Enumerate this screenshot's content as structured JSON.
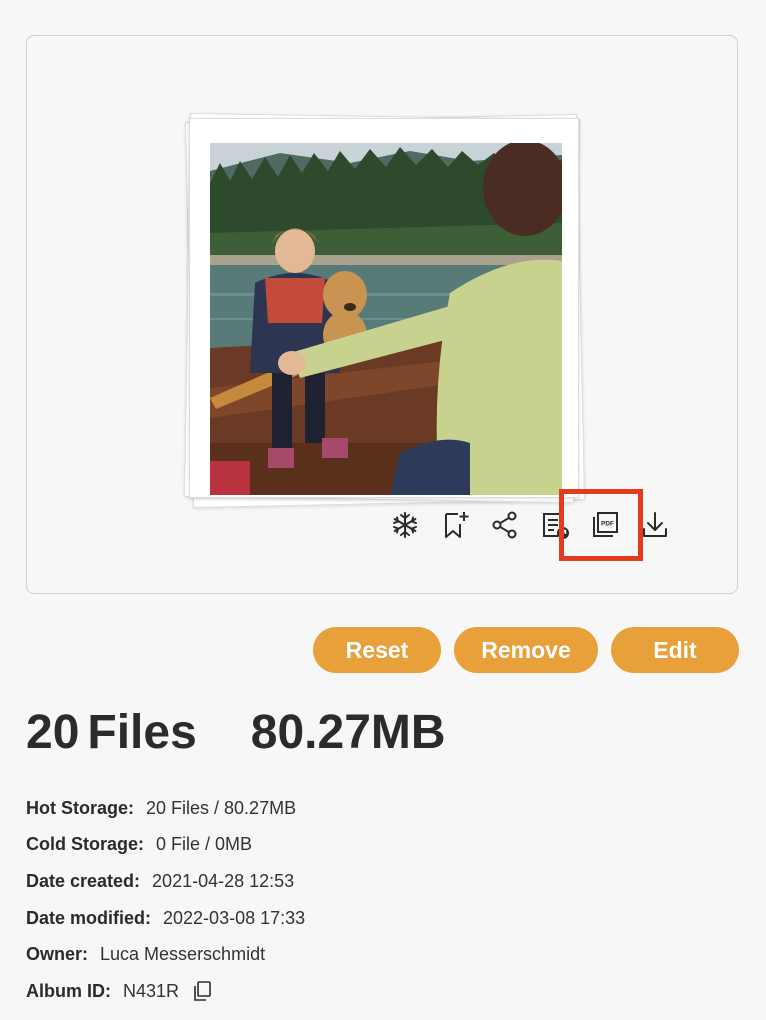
{
  "album": {
    "photo_alt": "Child and dog in a rowing boat on a lake with a woman rowing"
  },
  "actions": [
    {
      "name": "snowflake-icon",
      "label": "Cold storage"
    },
    {
      "name": "bookmark-add-icon",
      "label": "Add bookmark"
    },
    {
      "name": "share-icon",
      "label": "Share"
    },
    {
      "name": "document-export-icon",
      "label": "Export list"
    },
    {
      "name": "pdf-icon",
      "label": "PDF"
    },
    {
      "name": "download-icon",
      "label": "Download"
    }
  ],
  "buttons": {
    "reset": "Reset",
    "remove": "Remove",
    "edit": "Edit"
  },
  "summary": {
    "files": "20",
    "files_label": "Files",
    "size": "80.27MB"
  },
  "details": {
    "hot_storage_label": "Hot Storage:",
    "hot_storage_value": "20 Files / 80.27MB",
    "cold_storage_label": "Cold Storage:",
    "cold_storage_value": "0 File / 0MB",
    "date_created_label": "Date created:",
    "date_created_value": "2021-04-28 12:53",
    "date_modified_label": "Date modified:",
    "date_modified_value": "2022-03-08 17:33",
    "owner_label": "Owner:",
    "owner_value": "Luca Messerschmidt",
    "album_id_label": "Album ID:",
    "album_id_value": "N431R"
  },
  "colors": {
    "accent": "#e8a03a",
    "highlight": "#e63a1f"
  }
}
